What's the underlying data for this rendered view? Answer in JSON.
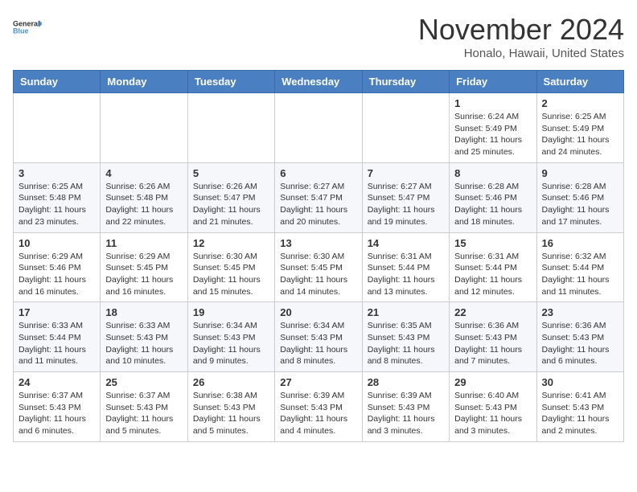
{
  "logo": {
    "line1": "General",
    "line2": "Blue"
  },
  "title": "November 2024",
  "location": "Honalo, Hawaii, United States",
  "days_of_week": [
    "Sunday",
    "Monday",
    "Tuesday",
    "Wednesday",
    "Thursday",
    "Friday",
    "Saturday"
  ],
  "weeks": [
    [
      {
        "day": "",
        "info": ""
      },
      {
        "day": "",
        "info": ""
      },
      {
        "day": "",
        "info": ""
      },
      {
        "day": "",
        "info": ""
      },
      {
        "day": "",
        "info": ""
      },
      {
        "day": "1",
        "info": "Sunrise: 6:24 AM\nSunset: 5:49 PM\nDaylight: 11 hours and 25 minutes."
      },
      {
        "day": "2",
        "info": "Sunrise: 6:25 AM\nSunset: 5:49 PM\nDaylight: 11 hours and 24 minutes."
      }
    ],
    [
      {
        "day": "3",
        "info": "Sunrise: 6:25 AM\nSunset: 5:48 PM\nDaylight: 11 hours and 23 minutes."
      },
      {
        "day": "4",
        "info": "Sunrise: 6:26 AM\nSunset: 5:48 PM\nDaylight: 11 hours and 22 minutes."
      },
      {
        "day": "5",
        "info": "Sunrise: 6:26 AM\nSunset: 5:47 PM\nDaylight: 11 hours and 21 minutes."
      },
      {
        "day": "6",
        "info": "Sunrise: 6:27 AM\nSunset: 5:47 PM\nDaylight: 11 hours and 20 minutes."
      },
      {
        "day": "7",
        "info": "Sunrise: 6:27 AM\nSunset: 5:47 PM\nDaylight: 11 hours and 19 minutes."
      },
      {
        "day": "8",
        "info": "Sunrise: 6:28 AM\nSunset: 5:46 PM\nDaylight: 11 hours and 18 minutes."
      },
      {
        "day": "9",
        "info": "Sunrise: 6:28 AM\nSunset: 5:46 PM\nDaylight: 11 hours and 17 minutes."
      }
    ],
    [
      {
        "day": "10",
        "info": "Sunrise: 6:29 AM\nSunset: 5:46 PM\nDaylight: 11 hours and 16 minutes."
      },
      {
        "day": "11",
        "info": "Sunrise: 6:29 AM\nSunset: 5:45 PM\nDaylight: 11 hours and 16 minutes."
      },
      {
        "day": "12",
        "info": "Sunrise: 6:30 AM\nSunset: 5:45 PM\nDaylight: 11 hours and 15 minutes."
      },
      {
        "day": "13",
        "info": "Sunrise: 6:30 AM\nSunset: 5:45 PM\nDaylight: 11 hours and 14 minutes."
      },
      {
        "day": "14",
        "info": "Sunrise: 6:31 AM\nSunset: 5:44 PM\nDaylight: 11 hours and 13 minutes."
      },
      {
        "day": "15",
        "info": "Sunrise: 6:31 AM\nSunset: 5:44 PM\nDaylight: 11 hours and 12 minutes."
      },
      {
        "day": "16",
        "info": "Sunrise: 6:32 AM\nSunset: 5:44 PM\nDaylight: 11 hours and 11 minutes."
      }
    ],
    [
      {
        "day": "17",
        "info": "Sunrise: 6:33 AM\nSunset: 5:44 PM\nDaylight: 11 hours and 11 minutes."
      },
      {
        "day": "18",
        "info": "Sunrise: 6:33 AM\nSunset: 5:43 PM\nDaylight: 11 hours and 10 minutes."
      },
      {
        "day": "19",
        "info": "Sunrise: 6:34 AM\nSunset: 5:43 PM\nDaylight: 11 hours and 9 minutes."
      },
      {
        "day": "20",
        "info": "Sunrise: 6:34 AM\nSunset: 5:43 PM\nDaylight: 11 hours and 8 minutes."
      },
      {
        "day": "21",
        "info": "Sunrise: 6:35 AM\nSunset: 5:43 PM\nDaylight: 11 hours and 8 minutes."
      },
      {
        "day": "22",
        "info": "Sunrise: 6:36 AM\nSunset: 5:43 PM\nDaylight: 11 hours and 7 minutes."
      },
      {
        "day": "23",
        "info": "Sunrise: 6:36 AM\nSunset: 5:43 PM\nDaylight: 11 hours and 6 minutes."
      }
    ],
    [
      {
        "day": "24",
        "info": "Sunrise: 6:37 AM\nSunset: 5:43 PM\nDaylight: 11 hours and 6 minutes."
      },
      {
        "day": "25",
        "info": "Sunrise: 6:37 AM\nSunset: 5:43 PM\nDaylight: 11 hours and 5 minutes."
      },
      {
        "day": "26",
        "info": "Sunrise: 6:38 AM\nSunset: 5:43 PM\nDaylight: 11 hours and 5 minutes."
      },
      {
        "day": "27",
        "info": "Sunrise: 6:39 AM\nSunset: 5:43 PM\nDaylight: 11 hours and 4 minutes."
      },
      {
        "day": "28",
        "info": "Sunrise: 6:39 AM\nSunset: 5:43 PM\nDaylight: 11 hours and 3 minutes."
      },
      {
        "day": "29",
        "info": "Sunrise: 6:40 AM\nSunset: 5:43 PM\nDaylight: 11 hours and 3 minutes."
      },
      {
        "day": "30",
        "info": "Sunrise: 6:41 AM\nSunset: 5:43 PM\nDaylight: 11 hours and 2 minutes."
      }
    ]
  ]
}
